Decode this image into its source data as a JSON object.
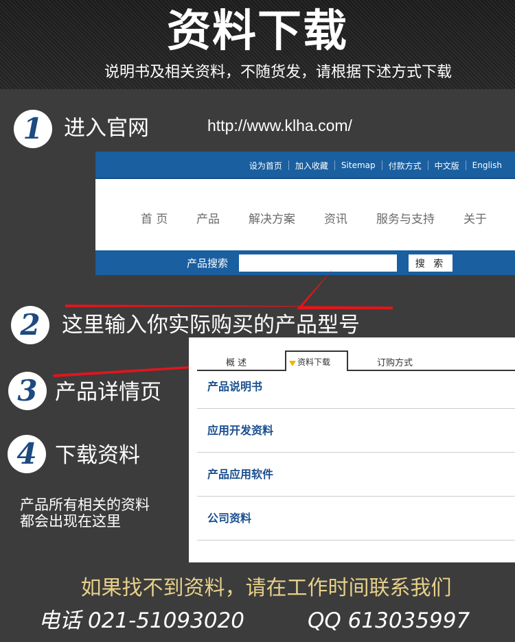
{
  "header": {
    "title": "资料下载",
    "subtitle": "说明书及相关资料，不随货发，请根据下述方式下载"
  },
  "steps": [
    {
      "number": "1",
      "label": "进入官网"
    },
    {
      "number": "2",
      "label": "这里输入你实际购买的产品型号"
    },
    {
      "number": "3",
      "label": "产品详情页"
    },
    {
      "number": "4",
      "label": "下载资料"
    }
  ],
  "url": "http://www.klha.com/",
  "site": {
    "top_links": [
      "设为首页",
      "加入收藏",
      "Sitemap",
      "付款方式",
      "中文版",
      "English"
    ],
    "nav": [
      "首 页",
      "产品",
      "解决方案",
      "资讯",
      "服务与支持",
      "关于"
    ],
    "search_label": "产品搜索",
    "search_value": "",
    "search_button": "搜 索"
  },
  "panel": {
    "tabs": [
      "概 述",
      "资料下载",
      "订购方式"
    ],
    "active_tab": "资料下载",
    "items": [
      "产品说明书",
      "应用开发资料",
      "产品应用软件",
      "公司资料"
    ]
  },
  "note": [
    "产品所有相关的资料",
    "都会出现在这里"
  ],
  "footer": {
    "line1": "如果找不到资料，请在工作时间联系我们",
    "phone": "电话 021-51093020",
    "qq": "QQ 613035997"
  },
  "colors": {
    "site_blue": "#1a5fa0",
    "step_number": "#1e4a80",
    "footer_gold": "#e7d089",
    "arrow_red": "#e0161c"
  }
}
